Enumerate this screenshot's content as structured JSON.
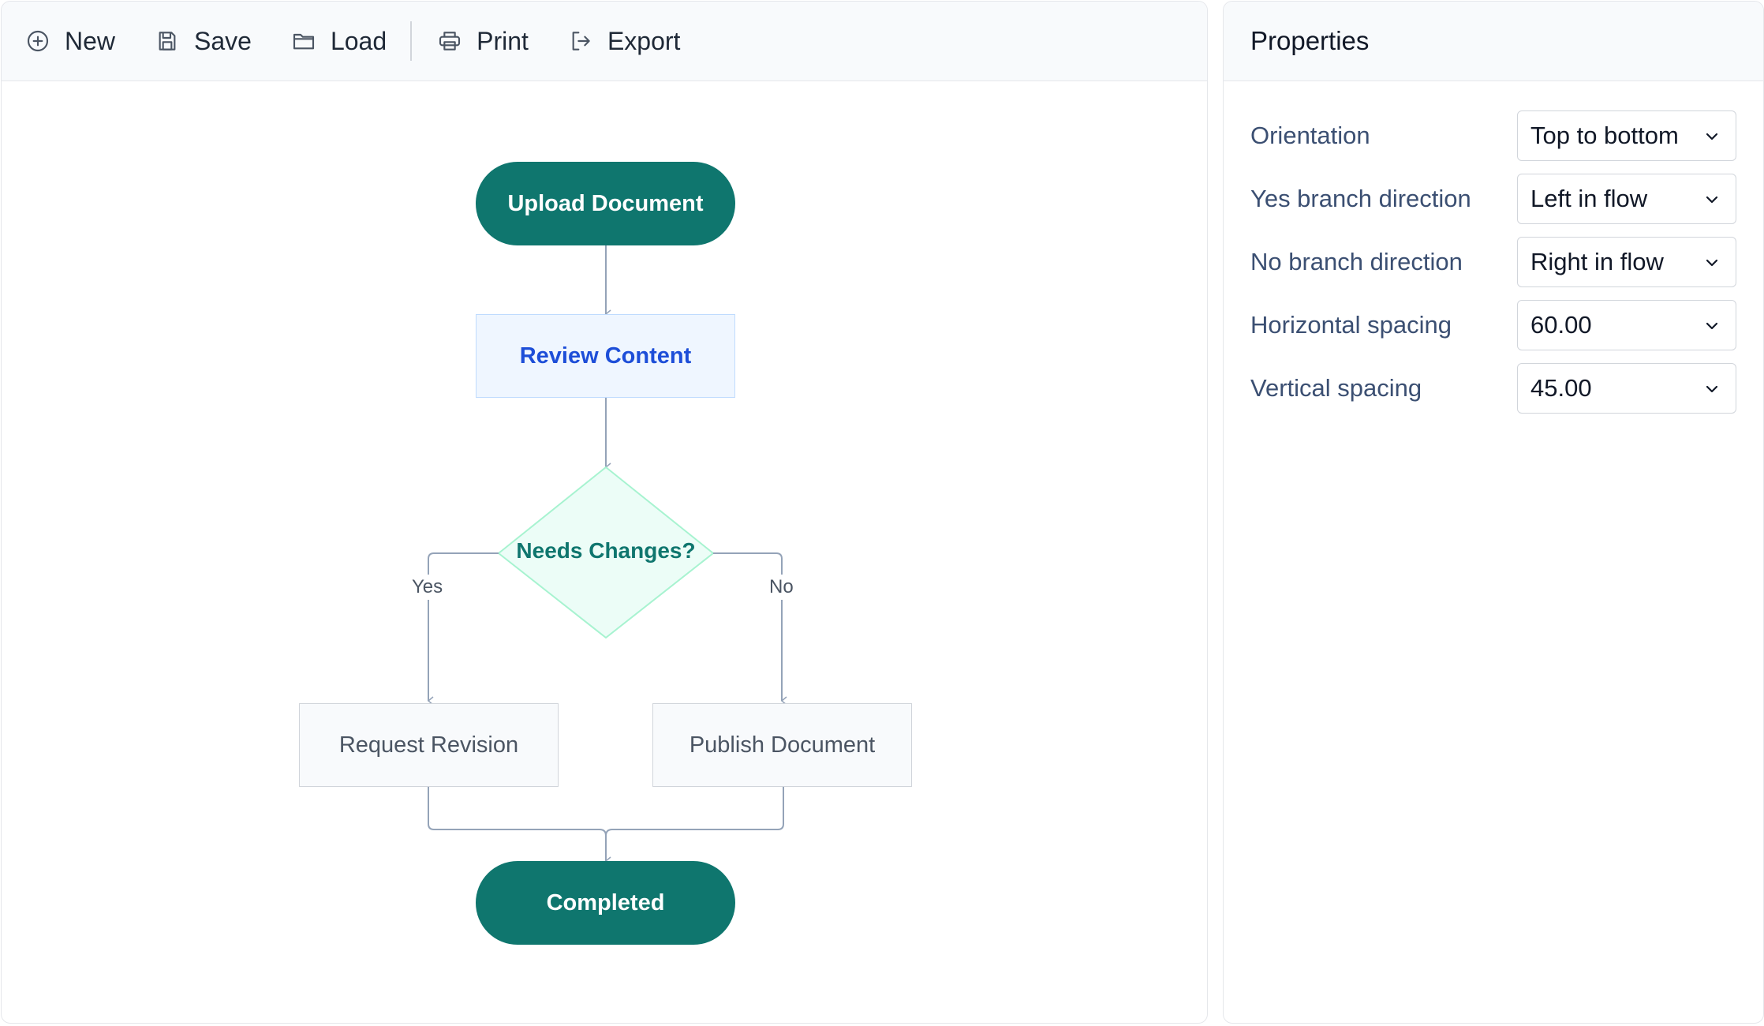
{
  "toolbar": {
    "new_label": "New",
    "save_label": "Save",
    "load_label": "Load",
    "print_label": "Print",
    "export_label": "Export"
  },
  "flowchart": {
    "start": "Upload Document",
    "review": "Review Content",
    "decision": "Needs Changes?",
    "yes_label": "Yes",
    "no_label": "No",
    "revision": "Request Revision",
    "publish": "Publish Document",
    "end": "Completed"
  },
  "properties": {
    "title": "Properties",
    "rows": [
      {
        "label": "Orientation",
        "value": "Top to bottom"
      },
      {
        "label": "Yes branch direction",
        "value": "Left in flow"
      },
      {
        "label": "No branch direction",
        "value": "Right in flow"
      },
      {
        "label": "Horizontal spacing",
        "value": "60.00"
      },
      {
        "label": "Vertical spacing",
        "value": "45.00"
      }
    ]
  },
  "colors": {
    "terminal": "#0f766e",
    "process_fill": "#eff6ff",
    "process_text": "#1d4ed8",
    "decision_fill": "#ecfdf7",
    "connector": "#94a3b8"
  }
}
